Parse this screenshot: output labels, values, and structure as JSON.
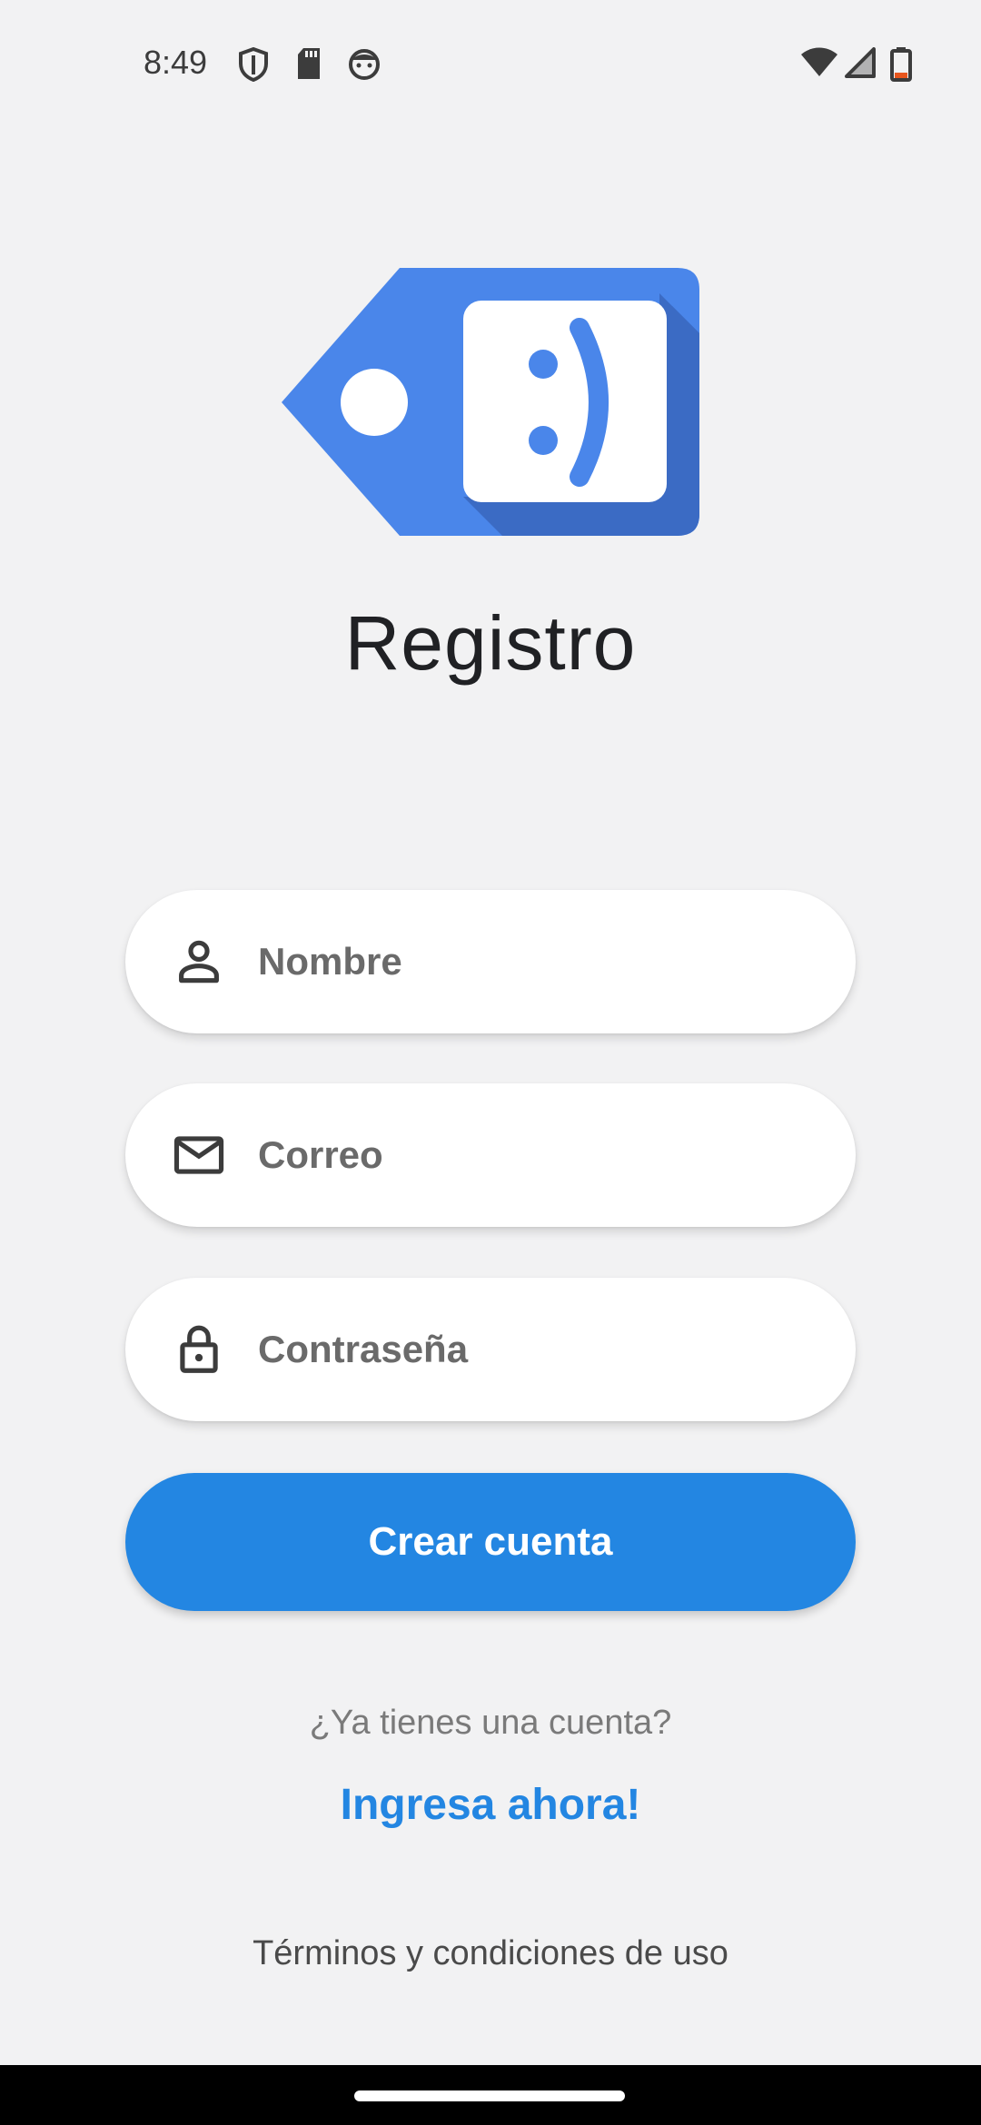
{
  "status_bar": {
    "time": "8:49",
    "icons": [
      "shield-icon",
      "sd-card-icon",
      "face-icon"
    ],
    "right_icons": [
      "wifi-icon",
      "signal-icon",
      "battery-icon"
    ]
  },
  "logo": {
    "name": "tag-smiley-logo",
    "glyph": ":)",
    "primary_color": "#4a86ea",
    "shadow_color": "#3b6bc4"
  },
  "title": "Registro",
  "form": {
    "name_field": {
      "placeholder": "Nombre",
      "value": "",
      "icon": "person-icon"
    },
    "email_field": {
      "placeholder": "Correo",
      "value": "",
      "icon": "mail-icon"
    },
    "password_field": {
      "placeholder": "Contraseña",
      "value": "",
      "icon": "lock-icon"
    },
    "submit_label": "Crear cuenta"
  },
  "footer": {
    "have_account": "¿Ya tienes una cuenta?",
    "login_link": "Ingresa ahora!",
    "terms": "Términos y condiciones de uso"
  },
  "colors": {
    "accent": "#2386e2",
    "background": "#f2f2f3"
  }
}
